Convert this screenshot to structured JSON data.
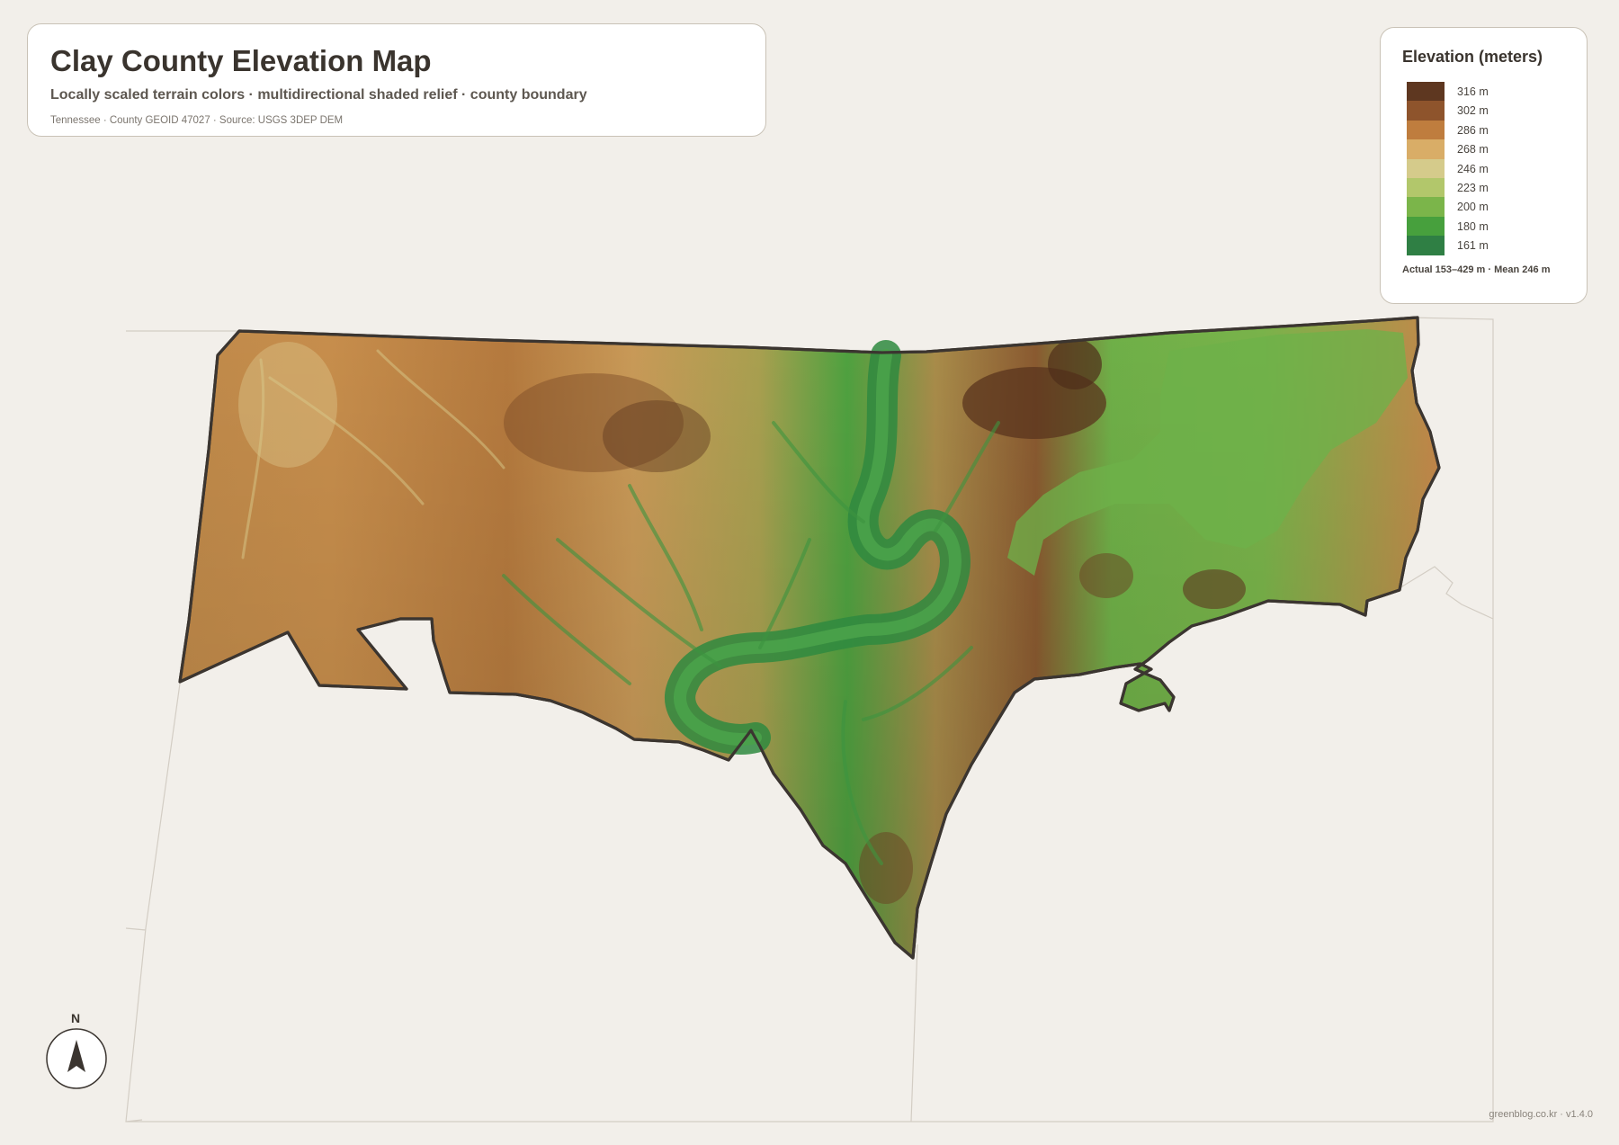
{
  "header": {
    "title": "Clay County Elevation Map",
    "subtitle": "Locally scaled terrain colors · multidirectional shaded relief · county boundary",
    "meta": "Tennessee · County GEOID 47027 · Source: USGS 3DEP DEM"
  },
  "legend": {
    "title": "Elevation (meters)",
    "items": [
      {
        "label": "316 m",
        "color": "#5e3720"
      },
      {
        "label": "302 m",
        "color": "#8e542c"
      },
      {
        "label": "286 m",
        "color": "#bf7d3e"
      },
      {
        "label": "268 m",
        "color": "#d9ad67"
      },
      {
        "label": "246 m",
        "color": "#d5cb8b"
      },
      {
        "label": "223 m",
        "color": "#b2c76b"
      },
      {
        "label": "200 m",
        "color": "#7bb54a"
      },
      {
        "label": "180 m",
        "color": "#47a03d"
      },
      {
        "label": "161 m",
        "color": "#2f7f44"
      }
    ],
    "footer": "Actual 153–429 m · Mean 246 m"
  },
  "north_arrow": {
    "label": "N"
  },
  "credit": "greenblog.co.kr · v1.4.0"
}
